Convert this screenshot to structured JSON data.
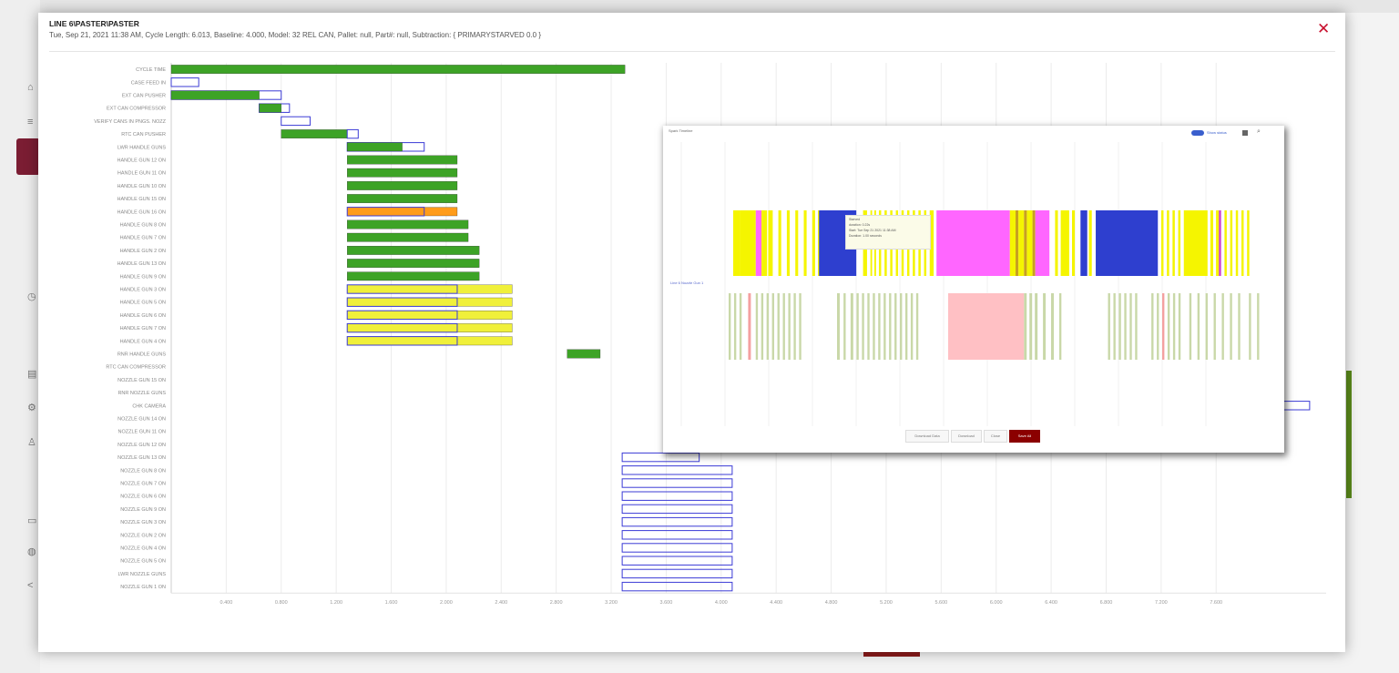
{
  "dialog": {
    "title": "LINE 6\\PASTER\\PASTER",
    "subtitle": "Tue, Sep 21, 2021 11:38 AM, Cycle Length: 6.013, Baseline: 4.000, Model: 32 REL CAN, Pallet: null, Part#: null, Subtraction: { PRIMARYSTARVED 0.0 }",
    "close_icon": "close-icon"
  },
  "popup": {
    "title": "Spark Timeline",
    "toggle_label": "Show status",
    "mid_link": "Line 6 Nozzle Gun 1",
    "tooltip": [
      "Starved",
      "duration: 0.22s",
      "Start: Tue Sep 21 2021 11:38 AM",
      "Duration: 1.00 seconds"
    ],
    "buttons": [
      "Download Data",
      "Download",
      "Close",
      "Save All"
    ]
  },
  "colors": {
    "green": "#3da326",
    "orange": "#ff9c1a",
    "yellow": "#f0f03a",
    "outline": "#3b3bd6",
    "accent": "#8b0000"
  },
  "chart_data": {
    "type": "gantt",
    "rows": [
      "CYCLE TIME",
      "CASE FEED IN",
      "EXT CAN PUSHER",
      "EXT CAN COMPRESSOR",
      "VERIFY CANS IN PNGS. NOZZ",
      "RTC CAN PUSHER",
      "LWR HANDLE GUNS",
      "HANDLE GUN 12 ON",
      "HANDLE GUN 11 ON",
      "HANDLE GUN 10 ON",
      "HANDLE GUN 15 ON",
      "HANDLE GUN 16 ON",
      "HANDLE GUN 8 ON",
      "HANDLE GUN 7 ON",
      "HANDLE GUN 2 ON",
      "HANDLE GUN 13 ON",
      "HANDLE GUN 9 ON",
      "HANDLE GUN 3 ON",
      "HANDLE GUN 5 ON",
      "HANDLE GUN 6 ON",
      "HANDLE GUN 7 ON",
      "HANDLE GUN 4 ON",
      "RNR HANDLE GUNS",
      "RTC CAN COMPRESSOR",
      "NOZZLE GUN 15 ON",
      "RNR NOZZLE GUNS",
      "CHK CAMERA",
      "NOZZLE GUN 14 ON",
      "NOZZLE GUN 11 ON",
      "NOZZLE GUN 12 ON",
      "NOZZLE GUN 13 ON",
      "NOZZLE GUN 8 ON",
      "NOZZLE GUN 7 ON",
      "NOZZLE GUN 6 ON",
      "NOZZLE GUN 9 ON",
      "NOZZLE GUN 3 ON",
      "NOZZLE GUN 2 ON",
      "NOZZLE GUN 4 ON",
      "NOZZLE GUN 5 ON",
      "LWR NOZZLE GUNS",
      "NOZZLE GUN 1 ON"
    ],
    "x_ticks": [
      "0.400",
      "0.800",
      "1.200",
      "1.600",
      "2.000",
      "2.400",
      "2.800",
      "3.200",
      "3.600",
      "4.000",
      "4.400",
      "4.800",
      "5.200",
      "5.600",
      "6.000",
      "6.400",
      "6.800",
      "7.200",
      "7.600"
    ],
    "x_ticks_raw": [
      0.4,
      0.8,
      1.2,
      1.6,
      2.0,
      2.4,
      2.8,
      3.2,
      3.6,
      4.0,
      4.4,
      4.8,
      5.2,
      5.6,
      6.0,
      6.4,
      6.8,
      7.2,
      7.6
    ],
    "bars": [
      {
        "row": 0,
        "start": 0.0,
        "end": 3.3,
        "color": "green"
      },
      {
        "row": 1,
        "start": 0.0,
        "end": 0.2,
        "color": "outline"
      },
      {
        "row": 2,
        "start": 0.0,
        "end": 0.8,
        "color": "outline"
      },
      {
        "row": 2,
        "start": 0.0,
        "end": 0.64,
        "color": "green"
      },
      {
        "row": 3,
        "start": 0.64,
        "end": 0.86,
        "color": "outline"
      },
      {
        "row": 3,
        "start": 0.64,
        "end": 0.8,
        "color": "green"
      },
      {
        "row": 4,
        "start": 0.8,
        "end": 1.01,
        "color": "outline"
      },
      {
        "row": 5,
        "start": 0.8,
        "end": 1.28,
        "color": "green"
      },
      {
        "row": 5,
        "start": 1.28,
        "end": 1.36,
        "color": "outline"
      },
      {
        "row": 6,
        "start": 1.28,
        "end": 1.84,
        "color": "outline"
      },
      {
        "row": 6,
        "start": 1.28,
        "end": 1.68,
        "color": "green"
      },
      {
        "row": 7,
        "start": 1.28,
        "end": 2.08,
        "color": "green"
      },
      {
        "row": 8,
        "start": 1.28,
        "end": 2.08,
        "color": "green"
      },
      {
        "row": 9,
        "start": 1.28,
        "end": 2.08,
        "color": "green"
      },
      {
        "row": 10,
        "start": 1.28,
        "end": 2.08,
        "color": "green"
      },
      {
        "row": 11,
        "start": 1.28,
        "end": 2.08,
        "color": "orange"
      },
      {
        "row": 11,
        "start": 1.28,
        "end": 1.84,
        "color": "outline"
      },
      {
        "row": 12,
        "start": 1.28,
        "end": 2.16,
        "color": "green"
      },
      {
        "row": 13,
        "start": 1.28,
        "end": 2.16,
        "color": "green"
      },
      {
        "row": 14,
        "start": 1.28,
        "end": 2.24,
        "color": "green"
      },
      {
        "row": 15,
        "start": 1.28,
        "end": 2.24,
        "color": "green"
      },
      {
        "row": 16,
        "start": 1.28,
        "end": 2.24,
        "color": "green"
      },
      {
        "row": 17,
        "start": 1.28,
        "end": 2.48,
        "color": "yellow"
      },
      {
        "row": 17,
        "start": 1.28,
        "end": 2.08,
        "color": "outline"
      },
      {
        "row": 18,
        "start": 1.28,
        "end": 2.48,
        "color": "yellow"
      },
      {
        "row": 18,
        "start": 1.28,
        "end": 2.08,
        "color": "outline"
      },
      {
        "row": 19,
        "start": 1.28,
        "end": 2.48,
        "color": "yellow"
      },
      {
        "row": 19,
        "start": 1.28,
        "end": 2.08,
        "color": "outline"
      },
      {
        "row": 20,
        "start": 1.28,
        "end": 2.48,
        "color": "yellow"
      },
      {
        "row": 20,
        "start": 1.28,
        "end": 2.08,
        "color": "outline"
      },
      {
        "row": 21,
        "start": 1.28,
        "end": 2.48,
        "color": "yellow"
      },
      {
        "row": 21,
        "start": 1.28,
        "end": 2.08,
        "color": "outline"
      },
      {
        "row": 22,
        "start": 2.88,
        "end": 3.12,
        "color": "green"
      },
      {
        "row": 26,
        "start": 7.96,
        "end": 8.28,
        "color": "outline"
      },
      {
        "row": 30,
        "start": 3.28,
        "end": 3.84,
        "color": "outline"
      },
      {
        "row": 31,
        "start": 3.28,
        "end": 4.08,
        "color": "outline"
      },
      {
        "row": 32,
        "start": 3.28,
        "end": 4.08,
        "color": "outline"
      },
      {
        "row": 33,
        "start": 3.28,
        "end": 4.08,
        "color": "outline"
      },
      {
        "row": 34,
        "start": 3.28,
        "end": 4.08,
        "color": "outline"
      },
      {
        "row": 35,
        "start": 3.28,
        "end": 4.08,
        "color": "outline"
      },
      {
        "row": 36,
        "start": 3.28,
        "end": 4.08,
        "color": "outline"
      },
      {
        "row": 37,
        "start": 3.28,
        "end": 4.08,
        "color": "outline"
      },
      {
        "row": 38,
        "start": 3.28,
        "end": 4.08,
        "color": "outline"
      },
      {
        "row": 39,
        "start": 3.28,
        "end": 4.08,
        "color": "outline"
      },
      {
        "row": 40,
        "start": 3.28,
        "end": 4.08,
        "color": "outline"
      }
    ],
    "strip1": [
      {
        "s": 0.0,
        "e": 0.012,
        "c": "#f5f500"
      },
      {
        "s": 0.012,
        "e": 0.04,
        "c": "#f5f500"
      },
      {
        "s": 0.04,
        "e": 0.05,
        "c": "#ff66ff"
      },
      {
        "s": 0.05,
        "e": 0.06,
        "c": "#f5f500"
      },
      {
        "s": 0.062,
        "e": 0.07,
        "c": "#f5f500"
      },
      {
        "s": 0.08,
        "e": 0.085,
        "c": "#f5f500"
      },
      {
        "s": 0.095,
        "e": 0.1,
        "c": "#f5f500"
      },
      {
        "s": 0.11,
        "e": 0.115,
        "c": "#f5f500"
      },
      {
        "s": 0.125,
        "e": 0.13,
        "c": "#f5f500"
      },
      {
        "s": 0.14,
        "e": 0.145,
        "c": "#f5f500"
      },
      {
        "s": 0.15,
        "e": 0.155,
        "c": "#f5f500"
      },
      {
        "s": 0.152,
        "e": 0.218,
        "c": "#2e3fcf"
      },
      {
        "s": 0.23,
        "e": 0.237,
        "c": "#f5f500"
      },
      {
        "s": 0.243,
        "e": 0.246,
        "c": "#f5f500"
      },
      {
        "s": 0.25,
        "e": 0.253,
        "c": "#f5f500"
      },
      {
        "s": 0.258,
        "e": 0.262,
        "c": "#f5f500"
      },
      {
        "s": 0.268,
        "e": 0.272,
        "c": "#f5f500"
      },
      {
        "s": 0.278,
        "e": 0.282,
        "c": "#f5f500"
      },
      {
        "s": 0.288,
        "e": 0.292,
        "c": "#f5f500"
      },
      {
        "s": 0.298,
        "e": 0.302,
        "c": "#f5f500"
      },
      {
        "s": 0.308,
        "e": 0.312,
        "c": "#f5f500"
      },
      {
        "s": 0.318,
        "e": 0.322,
        "c": "#f5f500"
      },
      {
        "s": 0.328,
        "e": 0.332,
        "c": "#f5f500"
      },
      {
        "s": 0.338,
        "e": 0.342,
        "c": "#f5f500"
      },
      {
        "s": 0.348,
        "e": 0.355,
        "c": "#f5f500"
      },
      {
        "s": 0.36,
        "e": 0.49,
        "c": "#ff66ff"
      },
      {
        "s": 0.49,
        "e": 0.5,
        "c": "#f5f500"
      },
      {
        "s": 0.5,
        "e": 0.505,
        "c": "#c8a020"
      },
      {
        "s": 0.505,
        "e": 0.515,
        "c": "#f5f500"
      },
      {
        "s": 0.515,
        "e": 0.52,
        "c": "#c8a020"
      },
      {
        "s": 0.52,
        "e": 0.53,
        "c": "#f5f500"
      },
      {
        "s": 0.53,
        "e": 0.535,
        "c": "#c8a020"
      },
      {
        "s": 0.535,
        "e": 0.56,
        "c": "#ff66ff"
      },
      {
        "s": 0.57,
        "e": 0.575,
        "c": "#f5f500"
      },
      {
        "s": 0.58,
        "e": 0.595,
        "c": "#f5f500"
      },
      {
        "s": 0.6,
        "e": 0.605,
        "c": "#f5f500"
      },
      {
        "s": 0.615,
        "e": 0.627,
        "c": "#2e3fcf"
      },
      {
        "s": 0.63,
        "e": 0.635,
        "c": "#f5f500"
      },
      {
        "s": 0.642,
        "e": 0.752,
        "c": "#2e3fcf"
      },
      {
        "s": 0.758,
        "e": 0.762,
        "c": "#f5f500"
      },
      {
        "s": 0.768,
        "e": 0.772,
        "c": "#f5f500"
      },
      {
        "s": 0.778,
        "e": 0.782,
        "c": "#f5f500"
      },
      {
        "s": 0.788,
        "e": 0.792,
        "c": "#f5f500"
      },
      {
        "s": 0.798,
        "e": 0.84,
        "c": "#f5f500"
      },
      {
        "s": 0.845,
        "e": 0.85,
        "c": "#f5f500"
      },
      {
        "s": 0.855,
        "e": 0.86,
        "c": "#f5f500"
      },
      {
        "s": 0.86,
        "e": 0.864,
        "c": "#cc44cc"
      },
      {
        "s": 0.87,
        "e": 0.874,
        "c": "#f5f500"
      },
      {
        "s": 0.88,
        "e": 0.884,
        "c": "#f5f500"
      },
      {
        "s": 0.89,
        "e": 0.894,
        "c": "#f5f500"
      },
      {
        "s": 0.9,
        "e": 0.904,
        "c": "#f5f500"
      },
      {
        "s": 0.91,
        "e": 0.914,
        "c": "#f5f500"
      }
    ],
    "strip2": [
      {
        "s": 0.0,
        "e": 0.004,
        "c": "#c9d8a8"
      },
      {
        "s": 0.01,
        "e": 0.014,
        "c": "#c9d8a8"
      },
      {
        "s": 0.02,
        "e": 0.024,
        "c": "#c9d8a8"
      },
      {
        "s": 0.036,
        "e": 0.041,
        "c": "#f4a0a0"
      },
      {
        "s": 0.05,
        "e": 0.054,
        "c": "#c9d8a8"
      },
      {
        "s": 0.06,
        "e": 0.064,
        "c": "#c9d8a8"
      },
      {
        "s": 0.07,
        "e": 0.074,
        "c": "#c9d8a8"
      },
      {
        "s": 0.08,
        "e": 0.084,
        "c": "#c9d8a8"
      },
      {
        "s": 0.09,
        "e": 0.094,
        "c": "#c9d8a8"
      },
      {
        "s": 0.1,
        "e": 0.104,
        "c": "#c9d8a8"
      },
      {
        "s": 0.11,
        "e": 0.114,
        "c": "#c9d8a8"
      },
      {
        "s": 0.12,
        "e": 0.124,
        "c": "#c9d8a8"
      },
      {
        "s": 0.13,
        "e": 0.134,
        "c": "#c9d8a8"
      },
      {
        "s": 0.2,
        "e": 0.205,
        "c": "#c9d8a8"
      },
      {
        "s": 0.212,
        "e": 0.216,
        "c": "#c9d8a8"
      },
      {
        "s": 0.225,
        "e": 0.23,
        "c": "#c9d8a8"
      },
      {
        "s": 0.236,
        "e": 0.24,
        "c": "#c9d8a8"
      },
      {
        "s": 0.246,
        "e": 0.25,
        "c": "#c9d8a8"
      },
      {
        "s": 0.256,
        "e": 0.26,
        "c": "#c9d8a8"
      },
      {
        "s": 0.266,
        "e": 0.27,
        "c": "#c9d8a8"
      },
      {
        "s": 0.276,
        "e": 0.28,
        "c": "#c9d8a8"
      },
      {
        "s": 0.286,
        "e": 0.29,
        "c": "#c9d8a8"
      },
      {
        "s": 0.296,
        "e": 0.3,
        "c": "#c9d8a8"
      },
      {
        "s": 0.306,
        "e": 0.31,
        "c": "#c9d8a8"
      },
      {
        "s": 0.316,
        "e": 0.32,
        "c": "#c9d8a8"
      },
      {
        "s": 0.326,
        "e": 0.33,
        "c": "#c9d8a8"
      },
      {
        "s": 0.336,
        "e": 0.34,
        "c": "#c9d8a8"
      },
      {
        "s": 0.346,
        "e": 0.35,
        "c": "#c9d8a8"
      },
      {
        "s": 0.405,
        "e": 0.545,
        "c": "#ffc0c4"
      },
      {
        "s": 0.545,
        "e": 0.55,
        "c": "#c9d8a8"
      },
      {
        "s": 0.555,
        "e": 0.56,
        "c": "#c9d8a8"
      },
      {
        "s": 0.565,
        "e": 0.57,
        "c": "#c9d8a8"
      },
      {
        "s": 0.58,
        "e": 0.585,
        "c": "#c9d8a8"
      },
      {
        "s": 0.595,
        "e": 0.6,
        "c": "#c9d8a8"
      },
      {
        "s": 0.61,
        "e": 0.614,
        "c": "#c9d8a8"
      },
      {
        "s": 0.7,
        "e": 0.704,
        "c": "#c9d8a8"
      },
      {
        "s": 0.71,
        "e": 0.714,
        "c": "#c9d8a8"
      },
      {
        "s": 0.72,
        "e": 0.724,
        "c": "#c9d8a8"
      },
      {
        "s": 0.73,
        "e": 0.734,
        "c": "#c9d8a8"
      },
      {
        "s": 0.74,
        "e": 0.744,
        "c": "#c9d8a8"
      },
      {
        "s": 0.75,
        "e": 0.754,
        "c": "#c9d8a8"
      },
      {
        "s": 0.78,
        "e": 0.784,
        "c": "#c9d8a8"
      },
      {
        "s": 0.79,
        "e": 0.794,
        "c": "#c9d8a8"
      },
      {
        "s": 0.8,
        "e": 0.804,
        "c": "#f4a0a0"
      },
      {
        "s": 0.81,
        "e": 0.814,
        "c": "#c9d8a8"
      },
      {
        "s": 0.82,
        "e": 0.824,
        "c": "#c9d8a8"
      },
      {
        "s": 0.83,
        "e": 0.834,
        "c": "#c9d8a8"
      },
      {
        "s": 0.85,
        "e": 0.854,
        "c": "#c9d8a8"
      },
      {
        "s": 0.865,
        "e": 0.869,
        "c": "#c9d8a8"
      },
      {
        "s": 0.88,
        "e": 0.884,
        "c": "#c9d8a8"
      },
      {
        "s": 0.895,
        "e": 0.899,
        "c": "#c9d8a8"
      },
      {
        "s": 0.91,
        "e": 0.914,
        "c": "#c9d8a8"
      },
      {
        "s": 0.925,
        "e": 0.929,
        "c": "#c9d8a8"
      },
      {
        "s": 0.94,
        "e": 0.944,
        "c": "#c9d8a8"
      },
      {
        "s": 0.96,
        "e": 0.964,
        "c": "#c9d8a8"
      },
      {
        "s": 0.975,
        "e": 0.979,
        "c": "#c9d8a8"
      }
    ]
  }
}
